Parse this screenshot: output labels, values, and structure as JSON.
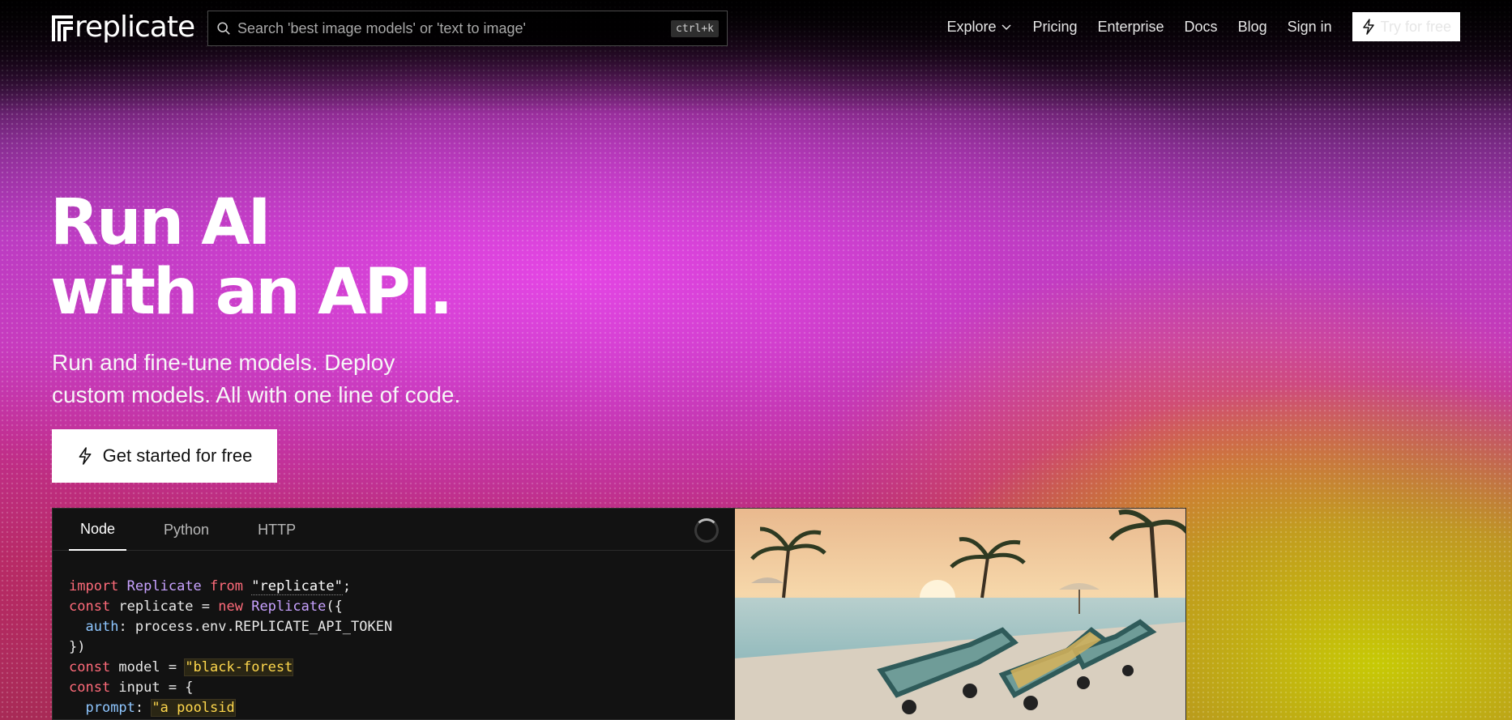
{
  "header": {
    "logo_text": "replicate",
    "search_placeholder": "Search 'best image models' or 'text to image'",
    "search_shortcut": "ctrl+k",
    "nav": {
      "explore": "Explore",
      "pricing": "Pricing",
      "enterprise": "Enterprise",
      "docs": "Docs",
      "blog": "Blog",
      "signin": "Sign in",
      "try": "Try for free"
    }
  },
  "hero": {
    "title_line1": "Run AI",
    "title_line2": "with an API.",
    "subtitle_line1": "Run and fine-tune models. Deploy",
    "subtitle_line2": "custom models. All with one line of code.",
    "cta": "Get started for free"
  },
  "code_panel": {
    "tabs": [
      "Node",
      "Python",
      "HTTP"
    ],
    "active_tab": "Node",
    "lines": [
      {
        "kw1": "import",
        "cls": "Replicate",
        "kw2": "from",
        "str": "\"replicate\"",
        "end": ";"
      },
      {
        "kw1": "const",
        "t1": " replicate = ",
        "kw2": "new",
        "cls": " Replicate",
        "end": "({"
      },
      {
        "prop": "auth",
        "t1": ": process.env.REPLICATE_API_TOKEN"
      },
      {
        "t1": "})"
      },
      {
        "kw1": "const",
        "t1": " model = ",
        "str": "\"black-forest"
      },
      {
        "kw1": "const",
        "t1": " input = {"
      },
      {
        "prop": "prompt",
        "t1": ": ",
        "str": "\"a poolsid"
      }
    ]
  },
  "image": {
    "description_icon": "poolside-lounge-chairs-image"
  }
}
